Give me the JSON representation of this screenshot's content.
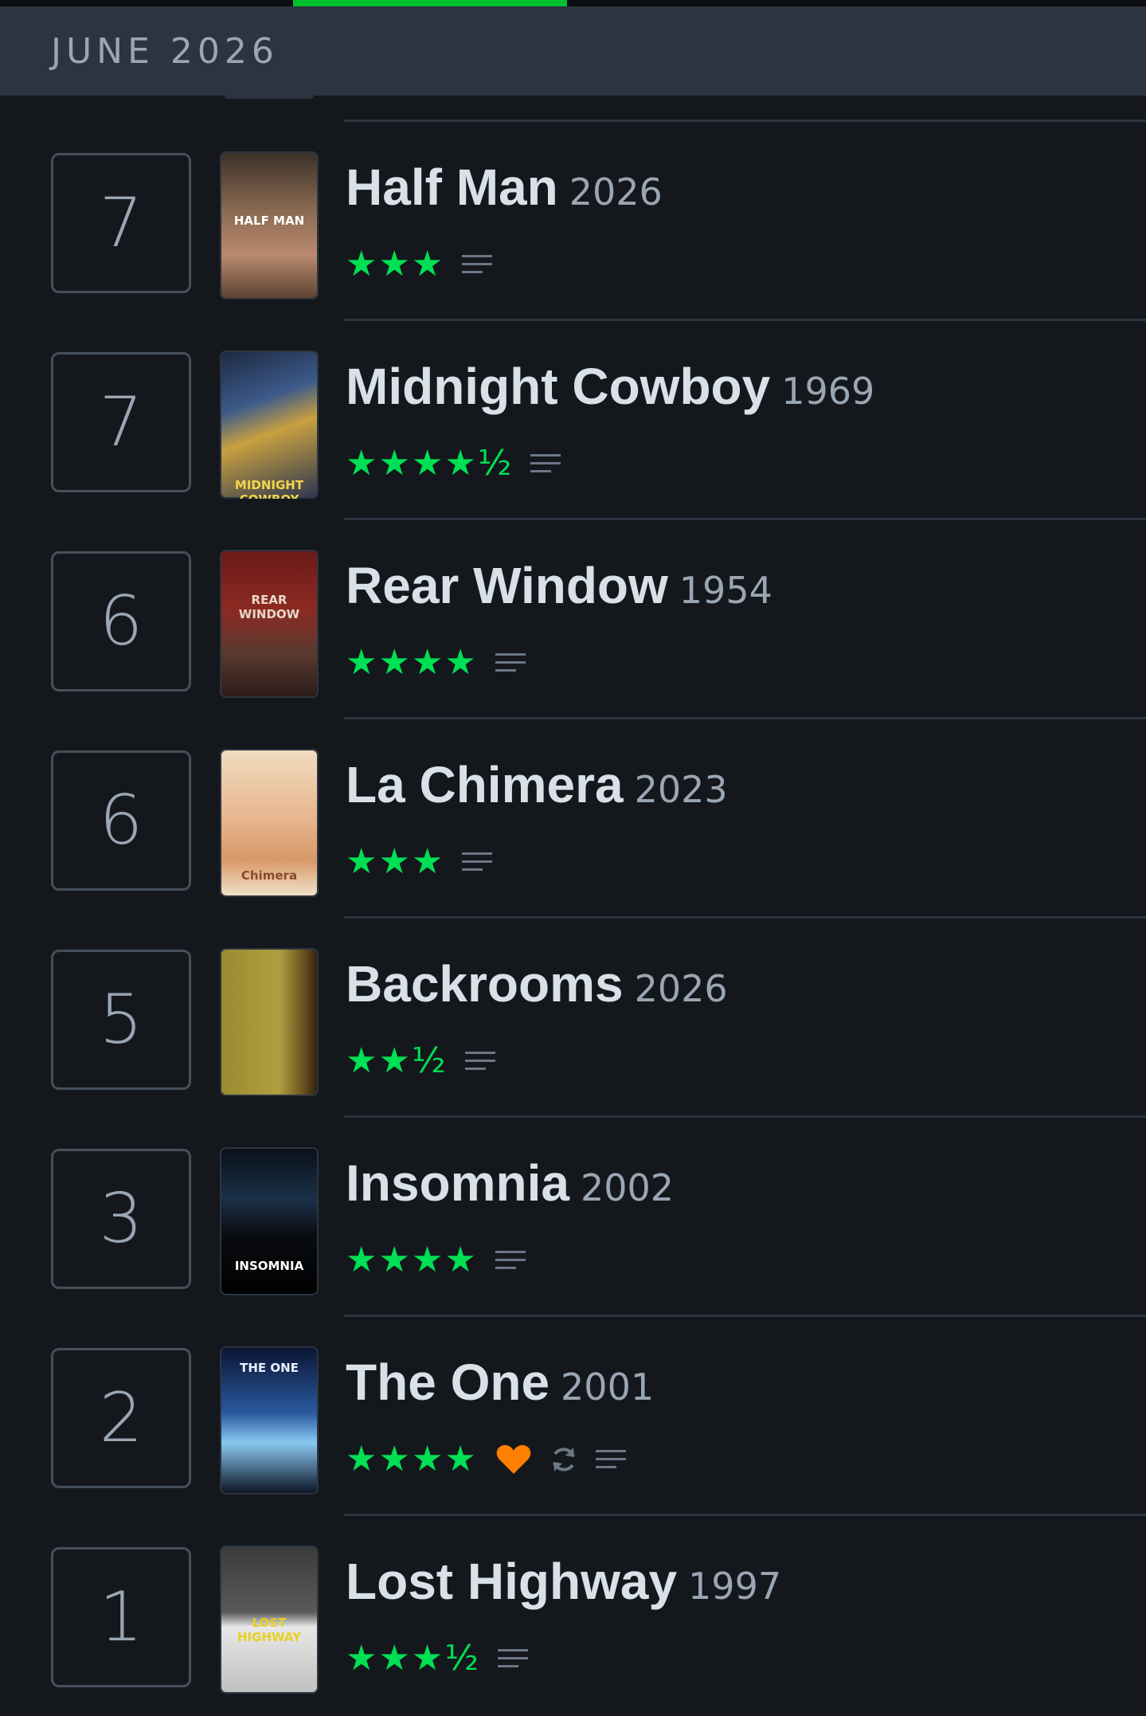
{
  "header": {
    "month": "JUNE 2026"
  },
  "colors": {
    "background": "#14181c",
    "header_bg": "#2c3440",
    "star_green": "#00e054",
    "progress_green": "#00c030",
    "heart_orange": "#ff8000"
  },
  "entries": [
    {
      "day": "7",
      "title": "Half Man",
      "year": "2026",
      "rating": "★★★",
      "rating_value": 3,
      "liked": false,
      "rewatch": false,
      "has_review": true,
      "poster_text": "HALF MAN"
    },
    {
      "day": "7",
      "title": "Midnight Cowboy",
      "year": "1969",
      "rating": "★★★★½",
      "rating_value": 4.5,
      "liked": false,
      "rewatch": false,
      "has_review": true,
      "poster_text": "MIDNIGHT COWBOY"
    },
    {
      "day": "6",
      "title": "Rear Window",
      "year": "1954",
      "rating": "★★★★",
      "rating_value": 4,
      "liked": false,
      "rewatch": false,
      "has_review": true,
      "poster_text": "REAR WINDOW"
    },
    {
      "day": "6",
      "title": "La Chimera",
      "year": "2023",
      "rating": "★★★",
      "rating_value": 3,
      "liked": false,
      "rewatch": false,
      "has_review": true,
      "poster_text": "Chimera"
    },
    {
      "day": "5",
      "title": "Backrooms",
      "year": "2026",
      "rating": "★★½",
      "rating_value": 2.5,
      "liked": false,
      "rewatch": false,
      "has_review": true,
      "poster_text": ""
    },
    {
      "day": "3",
      "title": "Insomnia",
      "year": "2002",
      "rating": "★★★★",
      "rating_value": 4,
      "liked": false,
      "rewatch": false,
      "has_review": true,
      "poster_text": "INSOMNIA"
    },
    {
      "day": "2",
      "title": "The One",
      "year": "2001",
      "rating": "★★★★",
      "rating_value": 4,
      "liked": true,
      "rewatch": true,
      "has_review": true,
      "poster_text": "THE ONE"
    },
    {
      "day": "1",
      "title": "Lost Highway",
      "year": "1997",
      "rating": "★★★½",
      "rating_value": 3.5,
      "liked": false,
      "rewatch": false,
      "has_review": true,
      "poster_text": "LOST HIGHWAY"
    }
  ],
  "icons": {
    "review": "review-lines-icon",
    "like": "heart-icon",
    "rewatch": "rewatch-icon"
  }
}
